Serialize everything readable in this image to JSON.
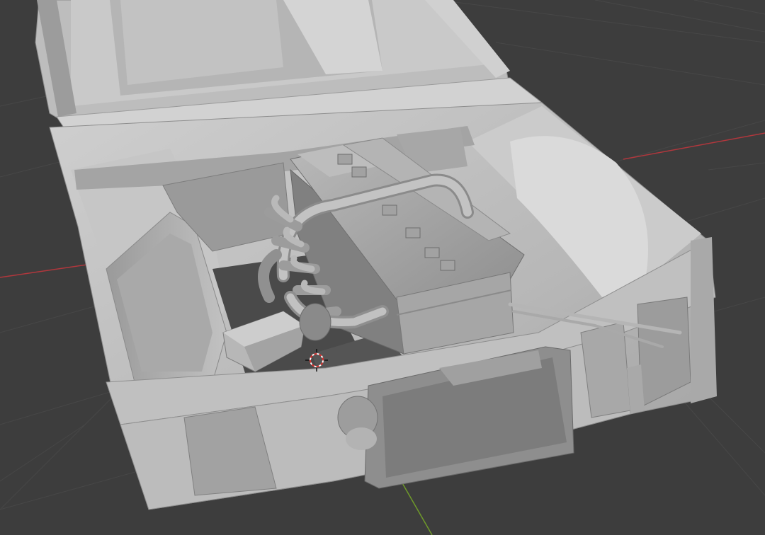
{
  "viewport": {
    "editor": "3D Viewport",
    "shading": "solid",
    "colors": {
      "background": "#3d3d3d",
      "grid": "#474747",
      "axis_x": "#b1373d",
      "axis_y": "#6f9a2a",
      "model_light": "#c8c8c8",
      "model_mid": "#a4a4a4",
      "model_dark": "#7a7a7a",
      "model_shadow": "#4a4a4a",
      "cursor_red": "#d8322f"
    },
    "icons": {
      "cursor": "3d-cursor-icon"
    }
  }
}
